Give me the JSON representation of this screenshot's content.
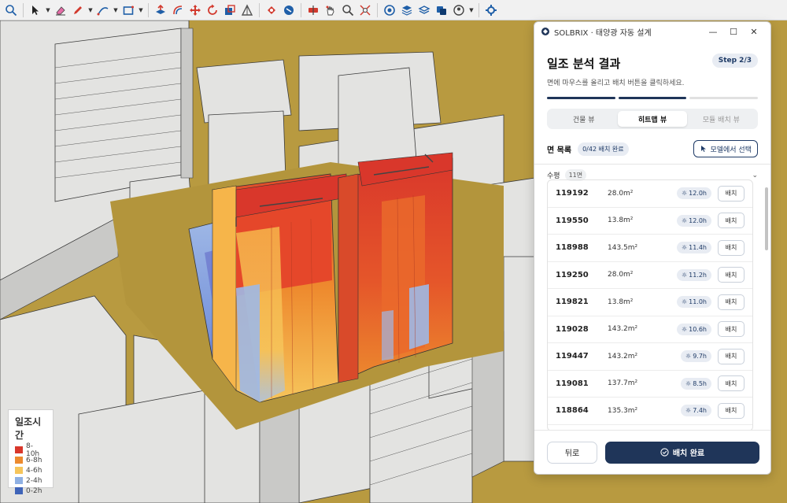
{
  "window": {
    "title": "SOLBRIX · 태양광 자동 설계",
    "controls": {
      "minimize": "—",
      "maximize": "☐",
      "close": "✕"
    }
  },
  "colors": {
    "accent": "#1f3559",
    "ground": "#b89a40",
    "building": "#e3e3e1"
  },
  "toolbar": {
    "icons": [
      "search-icon",
      "select-arrow-icon",
      "eraser-icon",
      "pencil-icon",
      "line-icon",
      "rectangle-icon",
      "push-pull-icon",
      "offset-icon",
      "move-icon",
      "rotate-icon",
      "scale-icon",
      "follow-me-icon",
      "measure-icon",
      "paint-icon",
      "section-icon",
      "hand-icon",
      "zoom-icon",
      "zoom-extents-icon",
      "component-icon",
      "layer-icon",
      "style-icon",
      "shadow-icon",
      "account-icon",
      "settings-gear-icon"
    ]
  },
  "legend": {
    "title": "일조시간",
    "items": [
      {
        "label": "8-10h",
        "color": "#d9372b"
      },
      {
        "label": "6-8h",
        "color": "#ec8a2e"
      },
      {
        "label": "4-6h",
        "color": "#f6c55b"
      },
      {
        "label": "2-4h",
        "color": "#8fb0e3"
      },
      {
        "label": "0-2h",
        "color": "#3f64b8"
      }
    ]
  },
  "panel": {
    "heading": "일조 분석 결과",
    "step": "Step 2/3",
    "subtitle": "면에 마우스를 올리고 배치 버튼을 클릭하세요.",
    "progress": [
      true,
      true,
      false
    ],
    "tabs": [
      {
        "label": "건물 뷰",
        "state": "normal"
      },
      {
        "label": "히트맵 뷰",
        "state": "active"
      },
      {
        "label": "모듈 배치 뷰",
        "state": "disabled"
      }
    ],
    "faces_label": "면 목록",
    "done_badge": "0/42 배치 완료",
    "select_in_model": "모델에서 선택",
    "group": {
      "name": "수평",
      "count": "11면",
      "chevron": "⌄"
    },
    "rows": [
      {
        "id": "119192",
        "area": "28.0m²",
        "hours": "12.0h",
        "action": "배치"
      },
      {
        "id": "119550",
        "area": "13.8m²",
        "hours": "12.0h",
        "action": "배치"
      },
      {
        "id": "118988",
        "area": "143.5m²",
        "hours": "11.4h",
        "action": "배치"
      },
      {
        "id": "119250",
        "area": "28.0m²",
        "hours": "11.2h",
        "action": "배치"
      },
      {
        "id": "119821",
        "area": "13.8m²",
        "hours": "11.0h",
        "action": "배치"
      },
      {
        "id": "119028",
        "area": "143.2m²",
        "hours": "10.6h",
        "action": "배치"
      },
      {
        "id": "119447",
        "area": "143.2m²",
        "hours": "9.7h",
        "action": "배치"
      },
      {
        "id": "119081",
        "area": "137.7m²",
        "hours": "8.5h",
        "action": "배치"
      },
      {
        "id": "118864",
        "area": "135.3m²",
        "hours": "7.4h",
        "action": "배치"
      }
    ],
    "back_label": "뒤로",
    "complete_label": "배치 완료"
  }
}
